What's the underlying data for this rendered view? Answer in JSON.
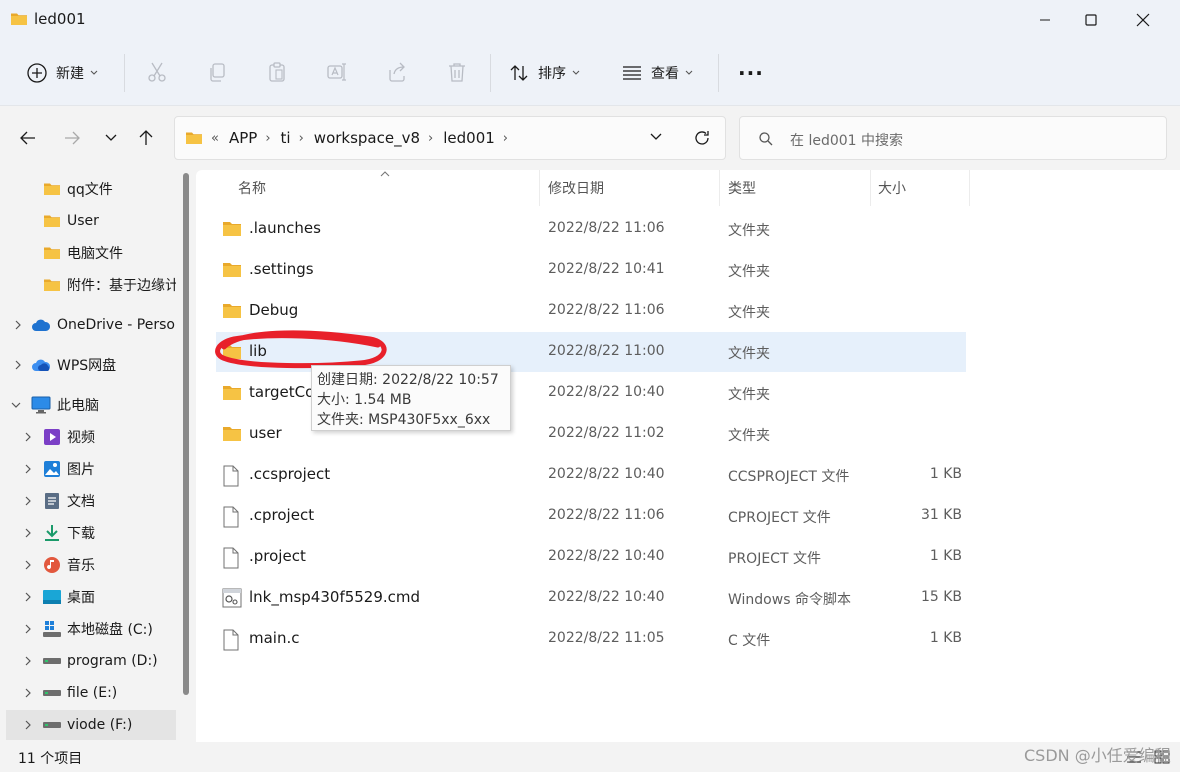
{
  "window": {
    "title": "led001"
  },
  "toolbar": {
    "new_label": "新建",
    "sort_label": "排序",
    "view_label": "查看",
    "more_label": "···"
  },
  "address": {
    "overflow": "«",
    "crumbs": [
      "APP",
      "ti",
      "workspace_v8",
      "led001"
    ]
  },
  "search": {
    "placeholder": "在 led001 中搜索"
  },
  "sidebar": {
    "items": [
      {
        "label": "qq文件",
        "icon": "folder-icon"
      },
      {
        "label": "User",
        "icon": "folder-icon"
      },
      {
        "label": "电脑文件",
        "icon": "folder-icon"
      },
      {
        "label": "附件：基于边缘计",
        "icon": "folder-icon"
      },
      {
        "label": "OneDrive - Personal",
        "icon": "cloud-icon"
      },
      {
        "label": "WPS网盘",
        "icon": "cloud-icon"
      },
      {
        "label": "此电脑",
        "icon": "monitor-icon"
      },
      {
        "label": "视频",
        "icon": "video-icon"
      },
      {
        "label": "图片",
        "icon": "picture-icon"
      },
      {
        "label": "文档",
        "icon": "document-icon"
      },
      {
        "label": "下载",
        "icon": "download-icon"
      },
      {
        "label": "音乐",
        "icon": "music-icon"
      },
      {
        "label": "桌面",
        "icon": "desktop-icon"
      },
      {
        "label": "本地磁盘 (C:)",
        "icon": "windows-drive-icon"
      },
      {
        "label": "program (D:)",
        "icon": "drive-icon"
      },
      {
        "label": "file (E:)",
        "icon": "drive-icon"
      },
      {
        "label": "viode (F:)",
        "icon": "drive-icon"
      }
    ]
  },
  "columns": {
    "name": "名称",
    "date": "修改日期",
    "type": "类型",
    "size": "大小"
  },
  "files": [
    {
      "name": ".launches",
      "date": "2022/8/22 11:06",
      "type": "文件夹",
      "size": "",
      "icon": "folder-icon"
    },
    {
      "name": ".settings",
      "date": "2022/8/22 10:41",
      "type": "文件夹",
      "size": "",
      "icon": "folder-icon"
    },
    {
      "name": "Debug",
      "date": "2022/8/22 11:06",
      "type": "文件夹",
      "size": "",
      "icon": "folder-icon"
    },
    {
      "name": "lib",
      "date": "2022/8/22 11:00",
      "type": "文件夹",
      "size": "",
      "icon": "folder-icon"
    },
    {
      "name": "targetCo",
      "date": "2022/8/22 10:40",
      "type": "文件夹",
      "size": "",
      "icon": "folder-icon"
    },
    {
      "name": "user",
      "date": "2022/8/22 11:02",
      "type": "文件夹",
      "size": "",
      "icon": "folder-icon"
    },
    {
      "name": ".ccsproject",
      "date": "2022/8/22 10:40",
      "type": "CCSPROJECT 文件",
      "size": "1 KB",
      "icon": "file-icon"
    },
    {
      "name": ".cproject",
      "date": "2022/8/22 11:06",
      "type": "CPROJECT 文件",
      "size": "31 KB",
      "icon": "file-icon"
    },
    {
      "name": ".project",
      "date": "2022/8/22 10:40",
      "type": "PROJECT 文件",
      "size": "1 KB",
      "icon": "file-icon"
    },
    {
      "name": "lnk_msp430f5529.cmd",
      "date": "2022/8/22 10:40",
      "type": "Windows 命令脚本",
      "size": "15 KB",
      "icon": "script-file-icon"
    },
    {
      "name": "main.c",
      "date": "2022/8/22 11:05",
      "type": "C 文件",
      "size": "1 KB",
      "icon": "file-icon"
    }
  ],
  "tooltip": {
    "line1": "创建日期: 2022/8/22 10:57",
    "line2": "大小: 1.54 MB",
    "line3": "文件夹: MSP430F5xx_6xx"
  },
  "status": {
    "count": "11 个项目"
  },
  "watermark": "CSDN @小任爱编程",
  "colors": {
    "accent": "#0067c0",
    "folder": "#f6c344",
    "annotation": "#e8202a",
    "hover": "#e6f0fb"
  }
}
